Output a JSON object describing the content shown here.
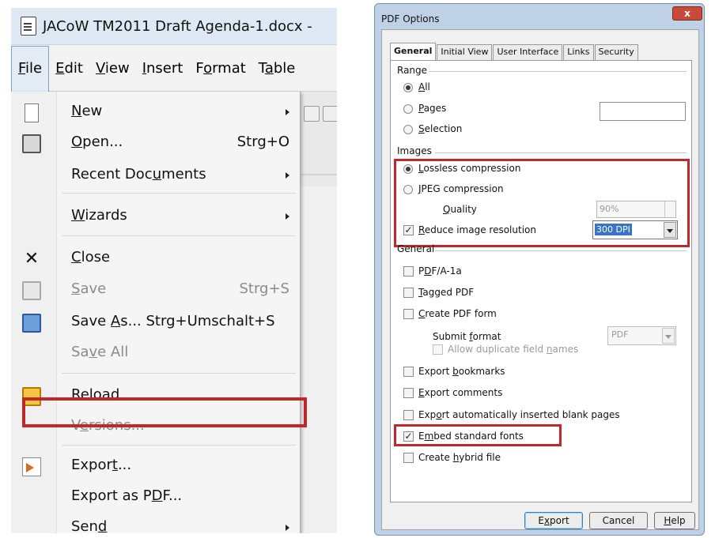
{
  "left": {
    "title": "JACoW TM2011 Draft Agenda-1.docx -",
    "menubar": [
      "File",
      "Edit",
      "View",
      "Insert",
      "Format",
      "Table"
    ],
    "menu_items": {
      "new": "New",
      "open": "Open...",
      "open_shortcut": "Strg+O",
      "recent": "Recent Documents",
      "wizards": "Wizards",
      "close": "Close",
      "save": "Save",
      "save_shortcut": "Strg+S",
      "save_as": "Save As...",
      "save_as_shortcut": "Strg+Umschalt+S",
      "save_all": "Save All",
      "reload": "Reload",
      "versions": "Versions...",
      "export": "Export...",
      "export_pdf": "Export as PDF...",
      "send": "Send"
    },
    "highlight_color": "#c0282e"
  },
  "dialog": {
    "title": "PDF Options",
    "close_glyph": "x",
    "tabs": [
      "General",
      "Initial View",
      "User Interface",
      "Links",
      "Security"
    ],
    "range": {
      "label": "Range",
      "all": "All",
      "pages": "Pages",
      "selection": "Selection",
      "pages_value": ""
    },
    "images": {
      "label": "Images",
      "lossless": "Lossless compression",
      "jpeg": "JPEG compression",
      "quality_label": "Quality",
      "quality_value": "90%",
      "reduce": "Reduce image resolution",
      "resolution_value": "300 DPI"
    },
    "general": {
      "label": "General",
      "pdfa": "PDF/A-1a",
      "tagged": "Tagged PDF",
      "create_form": "Create PDF form",
      "submit_format": "Submit format",
      "submit_format_value": "PDF",
      "allow_duplicates": "Allow duplicate field names",
      "export_bookmarks": "Export bookmarks",
      "export_comments": "Export comments",
      "export_blank": "Export automatically inserted blank pages",
      "embed_fonts": "Embed standard fonts",
      "hybrid": "Create hybrid file"
    },
    "checked": "✓",
    "buttons": {
      "export": "Export",
      "cancel": "Cancel",
      "help": "Help"
    }
  }
}
